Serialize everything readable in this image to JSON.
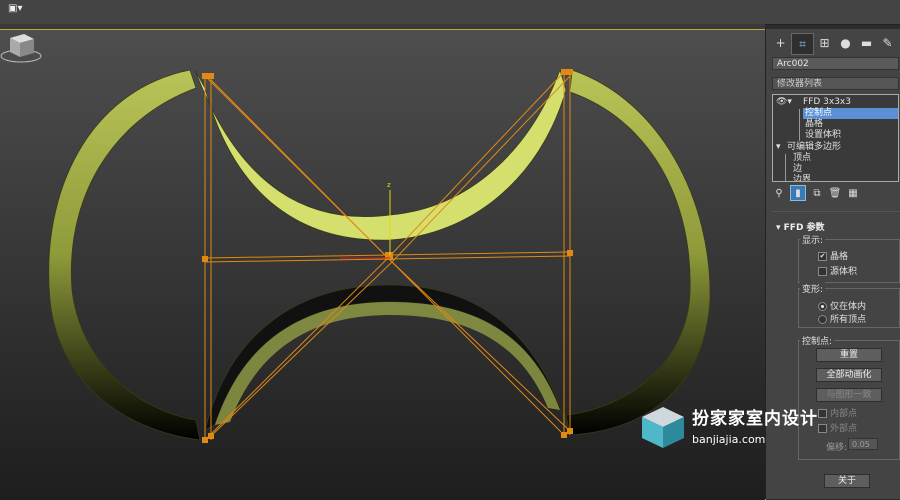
{
  "app": {
    "logo": "max-logo"
  },
  "panel": {
    "tabs": [
      {
        "icon": "create-plus-icon",
        "glyph": "+"
      },
      {
        "icon": "modify-icon",
        "glyph": "⌗"
      },
      {
        "icon": "hierarchy-icon",
        "glyph": "⊞"
      },
      {
        "icon": "motion-icon",
        "glyph": "●"
      },
      {
        "icon": "display-icon",
        "glyph": "▬"
      },
      {
        "icon": "utilities-icon",
        "glyph": "✎"
      }
    ],
    "object_name": "Arc002",
    "modifier_list": "修改器列表",
    "stack": {
      "ffd": "FFD 3x3x3",
      "ffd_children": [
        "控制点",
        "晶格",
        "设置体积"
      ],
      "poly": "可编辑多边形",
      "poly_children": [
        "顶点",
        "边",
        "边界"
      ]
    },
    "ffd_params": {
      "title": "FFD 参数",
      "display_label": "显示:",
      "lattice": "晶格",
      "source_volume": "源体积",
      "deform_label": "变形:",
      "only_in_volume": "仅在体内",
      "all_vertices": "所有顶点",
      "control_points_label": "控制点:",
      "reset": "重置",
      "animate_all": "全部动画化",
      "conform": "与图形一致",
      "inner_points": "内部点",
      "outer_points": "外部点",
      "offset_label": "偏移:",
      "offset_value": "0.05",
      "about": "关于"
    }
  },
  "viewport": {
    "axis_label": "z"
  },
  "watermark": {
    "title": "扮家家室内设计",
    "url": "banjiajia.com"
  }
}
